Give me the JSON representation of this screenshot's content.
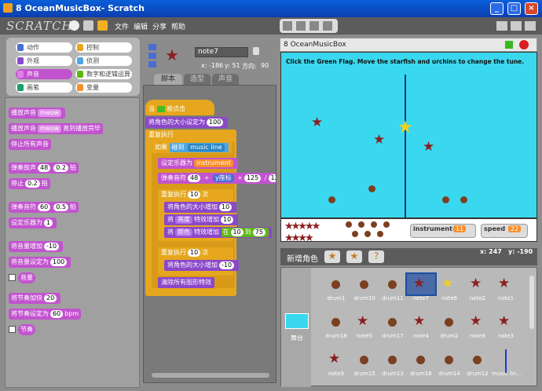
{
  "window": {
    "title": "8 OceanMusicBox- Scratch",
    "minimize": "_",
    "maximize": "□",
    "close": "×"
  },
  "menubar": {
    "logo": "SCRATCH",
    "items": [
      "文件",
      "编辑",
      "分享",
      "帮助"
    ]
  },
  "categories": [
    {
      "label": "动作",
      "color": "#4a6cd4",
      "selected": false
    },
    {
      "label": "控制",
      "color": "#e6a71e",
      "selected": false
    },
    {
      "label": "外观",
      "color": "#8b48c8",
      "selected": false
    },
    {
      "label": "侦测",
      "color": "#4fa6e0",
      "selected": false
    },
    {
      "label": "声音",
      "color": "#c253cf",
      "selected": true
    },
    {
      "label": "数字和逻辑运算",
      "color": "#5cb712",
      "selected": false
    },
    {
      "label": "画笔",
      "color": "#1b9e67",
      "selected": false
    },
    {
      "label": "变量",
      "color": "#f88f2a",
      "selected": false
    }
  ],
  "palette": {
    "b1": "播放声音",
    "b1v": "meow",
    "b2": "播放声音",
    "b2v": "meow",
    "b2s": "直到播放完毕",
    "b3": "停止所有声音",
    "b4": "弹奏鼓声",
    "b4v": "48",
    "b4n": "0.2",
    "b4s": "拍",
    "b5": "停止",
    "b5n": "0.2",
    "b5s": "拍",
    "b6": "弹奏音符",
    "b6v": "60",
    "b6n": "0.5",
    "b6s": "拍",
    "b7": "设定乐器为",
    "b7v": "1",
    "b8": "将音量增加",
    "b8v": "-10",
    "b9": "将音量设定为",
    "b9v": "100",
    "b10": "音量",
    "b11": "将节奏加快",
    "b11v": "20",
    "b12": "将节奏设定为",
    "b12v": "60",
    "b12s": "bpm",
    "b13": "节奏"
  },
  "sprite": {
    "name": "note7",
    "x_label": "x: -186",
    "y_label": "y: 51",
    "dir_label": "方向:",
    "dir": "90"
  },
  "tabs": [
    "脚本",
    "造型",
    "声音"
  ],
  "script": {
    "hat": "当",
    "hat2": "被点击",
    "s1": "将角色的大小设定为",
    "s1v": "100",
    "forever": "重复执行",
    "if": "如果",
    "touch": "碰到",
    "touchv": "music line",
    "instr": "设定乐器为",
    "instrv": "instrument",
    "note": "弹奏音符",
    "n1": "48",
    "plus": "+",
    "ypos": "y座标",
    "n2": "125",
    "div": "/",
    "n3": "12",
    "rep1": "重复执行",
    "rep1v": "10",
    "times": "次",
    "grow": "将角色的大小增加",
    "growv": "10",
    "bright": "将",
    "brightv": "亮度",
    "brightfx": "特效增加",
    "brightn": "10",
    "color": "将",
    "colorv": "颜色",
    "colorfx": "特效增加",
    "rnd": "在",
    "rnda": "10",
    "rndb": "到",
    "rndc": "75",
    "rep2": "重复执行",
    "rep2v": "10",
    "times2": "次",
    "grow2": "将角色的大小增加",
    "grow2v": "-10",
    "clear": "清除所有图形特效"
  },
  "stage": {
    "title": "8 OceanMusicBox",
    "instruction": "Click the Green Flag. Move the starfish and urchins to change the tune.",
    "monitors": [
      {
        "label": "instrument",
        "value": "11"
      },
      {
        "label": "speed",
        "value": "22"
      }
    ],
    "mouse_x": "x: 247",
    "mouse_y": "y: -190"
  },
  "library": {
    "header": "新增角色",
    "stage_label": "舞台",
    "sprites": [
      [
        "drum1",
        "drum10",
        "drum11",
        "note7",
        "note6",
        "note2",
        "note1"
      ],
      [
        "drum18",
        "note5",
        "drum17",
        "note4",
        "drum2",
        "note8",
        "note3"
      ],
      [
        "note9",
        "drum15",
        "drum13",
        "drum16",
        "drum14",
        "drum12",
        "music lin..."
      ]
    ],
    "selected": "note7"
  }
}
